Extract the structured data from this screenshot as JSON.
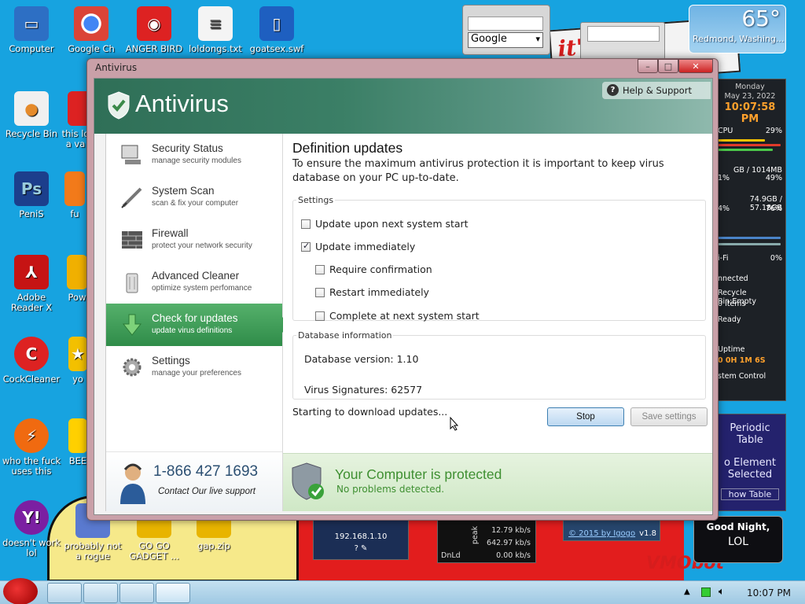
{
  "desktop_icons": [
    {
      "label": "Computer",
      "color": "#2d6fc4"
    },
    {
      "label": "Google Ch",
      "color": "#e8e8e8"
    },
    {
      "label": "ANGER BIRD",
      "color": "#d22"
    },
    {
      "label": "loldongs.txt",
      "color": "#f4f4f4"
    },
    {
      "label": "goatsex.swf",
      "color": "#1e5fc0"
    },
    {
      "label": "Recycle Bin",
      "color": "#f0f0f0"
    },
    {
      "label": "this lo a va",
      "color": "#d22"
    },
    {
      "label": "PeniS",
      "color": "#1c3f8c"
    },
    {
      "label": "fu",
      "color": "#f27a1a"
    },
    {
      "label": "Adobe Reader X",
      "color": "#c61414"
    },
    {
      "label": "Pow",
      "color": "#f0b000"
    },
    {
      "label": "CockCleaner",
      "color": "#d22"
    },
    {
      "label": "yo",
      "color": "#f3c000"
    },
    {
      "label": "who the fuck uses this",
      "color": "#f06a10"
    },
    {
      "label": "BEE",
      "color": "#ffd000"
    },
    {
      "label": "doesn't work lol",
      "color": "#7b1fa2"
    },
    {
      "label": "probably not a rogue",
      "color": "#5a7ad0"
    },
    {
      "label": "GO GO GADGET ...",
      "color": "#e8b400"
    },
    {
      "label": "gap.zip",
      "color": "#e8b400"
    }
  ],
  "google_gadget": {
    "engine": "Google"
  },
  "weather": {
    "temp": "65°",
    "location": "Redmond, Washing..."
  },
  "sysmon": {
    "day": "Monday",
    "date": "May 23, 2022",
    "time": "10:07:58 PM",
    "cpu_label": "CPU",
    "cpu_pct": "29%",
    "mem": "GB / 1014MB",
    "mem_pct": "49%",
    "mem_left": "1%",
    "disk": "74.9GB / 57.18GB",
    "disk_pct": "76%",
    "disk_left": "4%",
    "wifi_label": "i-Fi",
    "wifi_pct": "0%",
    "connected": "nnected",
    "recycle": "Recycle Bin:Empty",
    "items": "0 items",
    "ready": "Ready",
    "uptime_label": "Uptime",
    "uptime": "0 0H 1M 6S",
    "control": "stem Control"
  },
  "periodic": {
    "title1": "Periodic",
    "title2": "Table",
    "l1": "o Element",
    "l2": "Selected",
    "btn": "how Table"
  },
  "goodnight": {
    "line1": "Good Night,",
    "line2": "LOL"
  },
  "net": {
    "ip": "192.168.1.10",
    "q": "? ✎"
  },
  "netspeed": {
    "r1": "12.79 kb/s",
    "peak": "peak",
    "r2": "642.97 kb/s",
    "dnld": "DnLd",
    "r3": "0.00 kb/s"
  },
  "connection": {
    "copyright": "© 2015 by Igogo",
    "ver": "v1.8"
  },
  "wallpaper": {
    "banner": "it's a p e",
    "brand": "VMObot"
  },
  "antivirus": {
    "window_title": "Antivirus",
    "logo": "Antivirus",
    "help": "Help & Support",
    "nav": [
      {
        "label": "Security Status",
        "sub": "manage security modules"
      },
      {
        "label": "System Scan",
        "sub": "scan & fix your computer"
      },
      {
        "label": "Firewall",
        "sub": "protect your network security"
      },
      {
        "label": "Advanced Cleaner",
        "sub": "optimize system perfomance"
      },
      {
        "label": "Check for updates",
        "sub": "update virus definitions"
      },
      {
        "label": "Settings",
        "sub": "manage your preferences"
      }
    ],
    "phone": "1-866 427 1693",
    "contact": "Contact Our live support",
    "page_title": "Definition updates",
    "description": "To ensure the maximum antivirus protection it is important to keep virus database on your PC up-to-date.",
    "settings_legend": "Settings",
    "options": [
      {
        "label": "Update upon next system start",
        "checked": false
      },
      {
        "label": "Update immediately",
        "checked": true
      },
      {
        "label": "Require confirmation",
        "checked": false
      },
      {
        "label": "Restart immediately",
        "checked": false
      },
      {
        "label": "Complete at next system start",
        "checked": false
      }
    ],
    "db_legend": "Database information",
    "db_version": "Database version: 1.10",
    "virus_sigs": "Virus Signatures: 62577",
    "progress": "Starting to download updates...",
    "stop": "Stop",
    "save": "Save settings",
    "status_title": "Your Computer is protected",
    "status_sub": "No problems detected."
  },
  "taskbar": {
    "clock": "10:07 PM"
  }
}
